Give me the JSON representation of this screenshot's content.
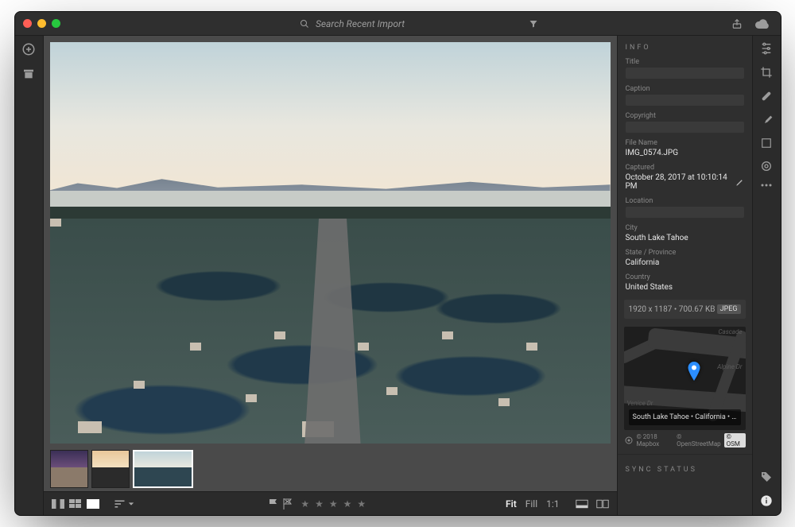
{
  "titlebar": {
    "search_placeholder": "Search Recent Import"
  },
  "info_panel": {
    "section_title": "INFO",
    "title_label": "Title",
    "caption_label": "Caption",
    "copyright_label": "Copyright",
    "filename_label": "File Name",
    "filename_value": "IMG_0574.JPG",
    "captured_label": "Captured",
    "captured_value": "October 28, 2017 at 10:10:14 PM",
    "location_label": "Location",
    "city_label": "City",
    "city_value": "South Lake Tahoe",
    "state_label": "State / Province",
    "state_value": "California",
    "country_label": "Country",
    "country_value": "United States",
    "dimensions": "1920 x 1187",
    "filesize": "700.67 KB",
    "filetype_badge": "JPEG"
  },
  "map": {
    "street1": "Cascade",
    "street2": "Alpine Dr",
    "street3": "Venice Dr",
    "caption": "South Lake Tahoe • California • U…",
    "attrib_mapbox": "© 2018 Mapbox",
    "attrib_osm": "© OpenStreetMap",
    "attrib_osm_badge": "© OSM"
  },
  "sync": {
    "section_title": "SYNC STATUS"
  },
  "bottom": {
    "fit": "Fit",
    "fill": "Fill",
    "one_to_one": "1:1"
  }
}
